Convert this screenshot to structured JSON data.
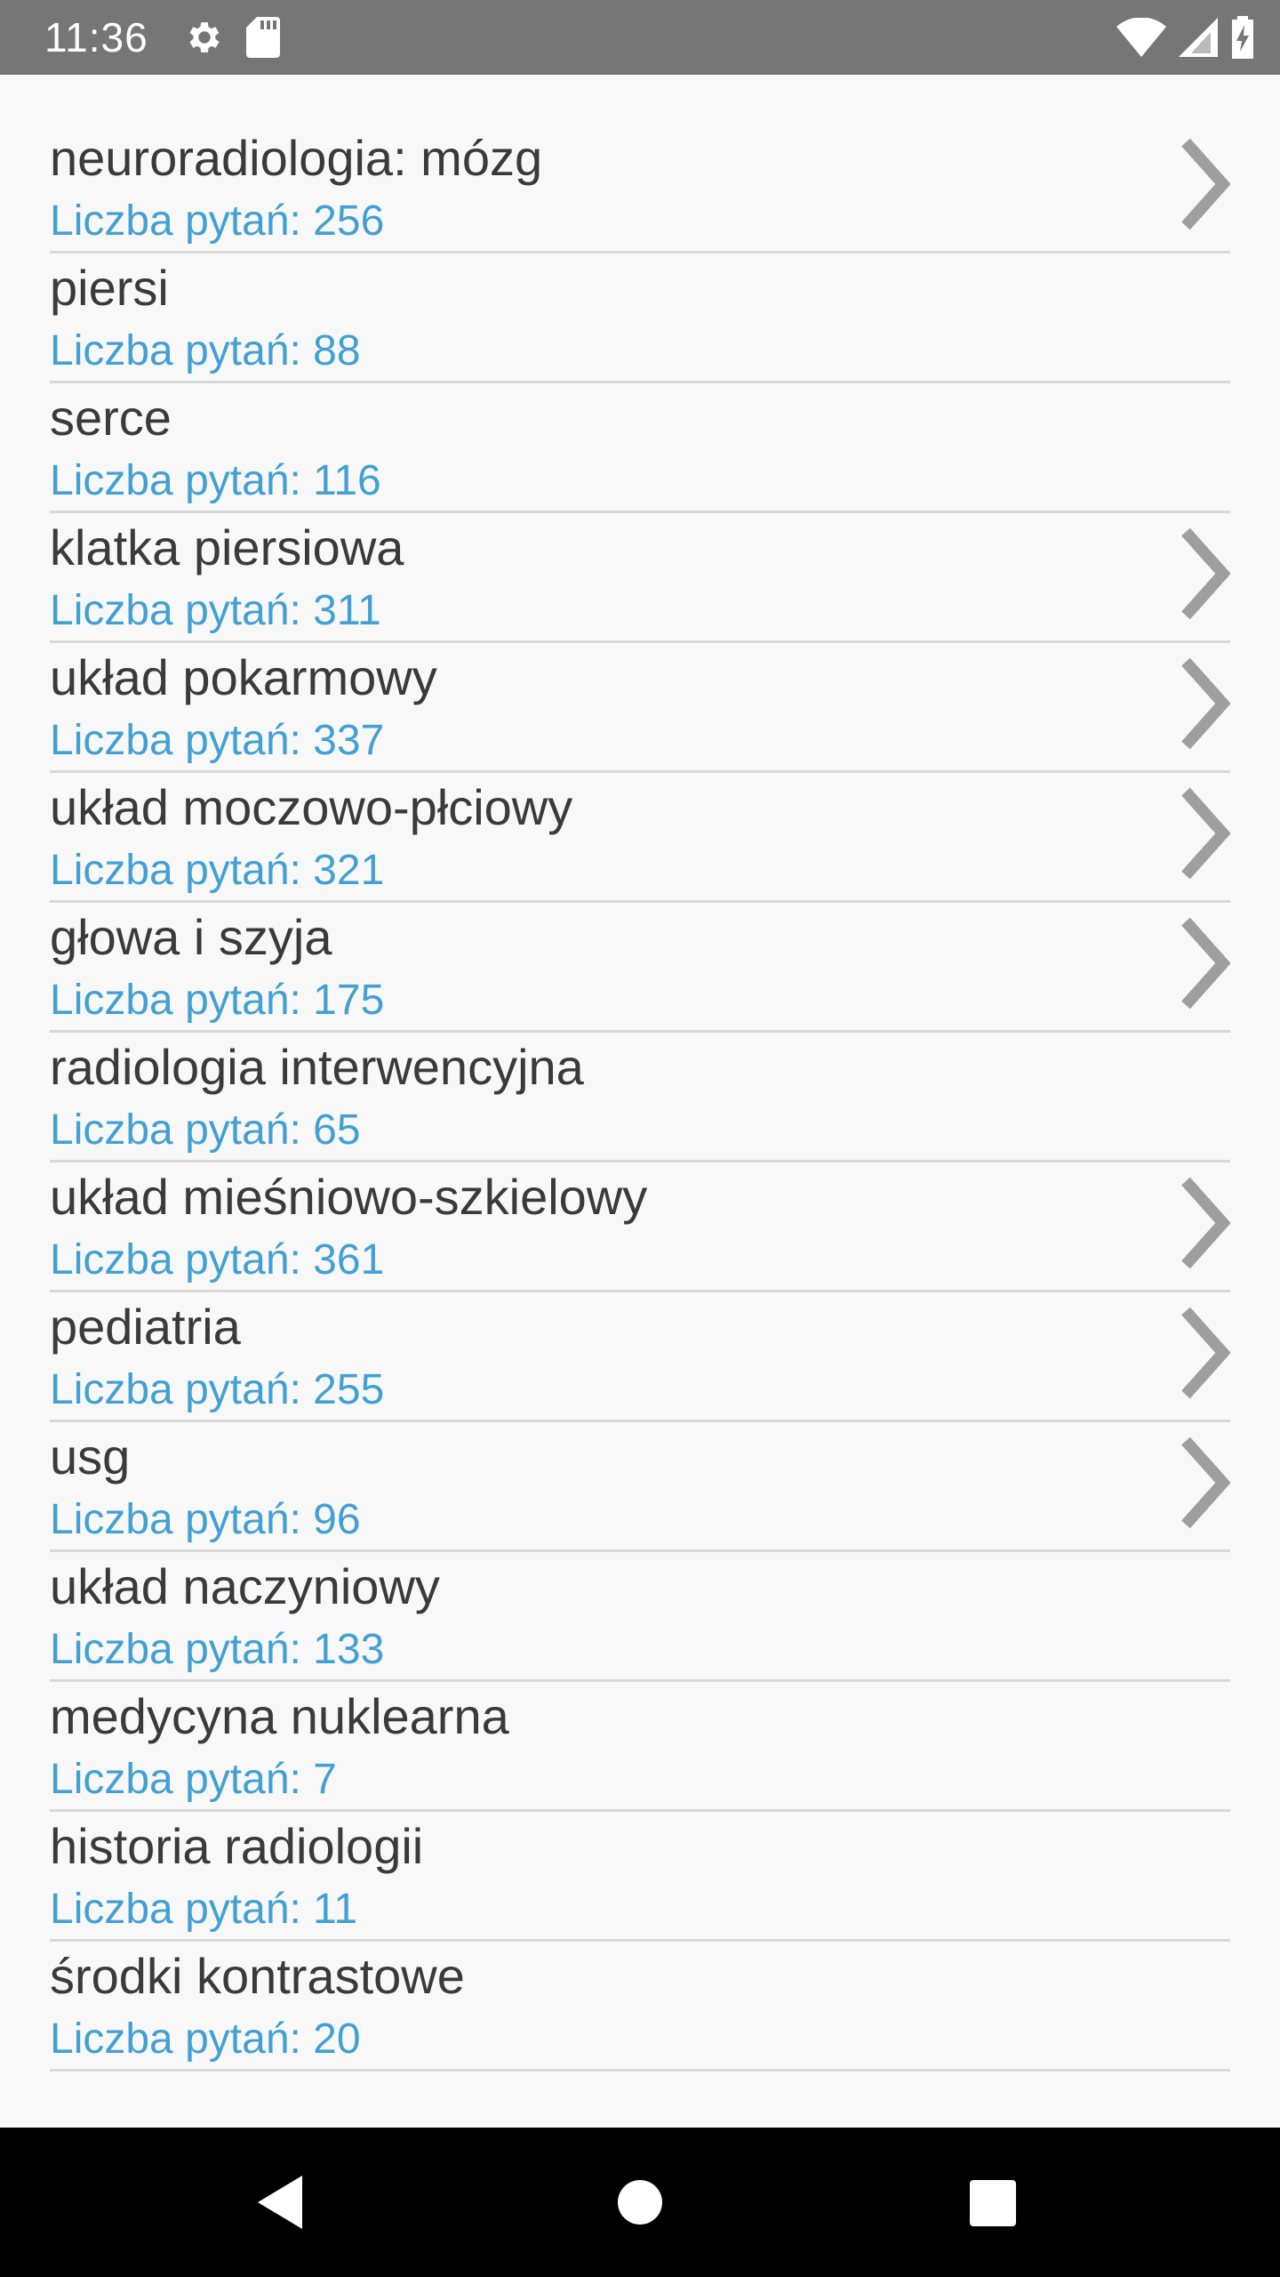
{
  "status_bar": {
    "time": "11:36",
    "icons": [
      "gear-icon",
      "sd-card-icon",
      "wifi-icon",
      "signal-icon",
      "battery-charging-icon"
    ]
  },
  "colors": {
    "status_bar_bg": "#767676",
    "background": "#f8f8f8",
    "title_text": "#3a3a3a",
    "count_text": "#43a0d3",
    "divider": "#d8d8d8",
    "chevron": "#9e9e9e",
    "nav_bar_bg": "#000000"
  },
  "categories": [
    {
      "title": "neuroradiologia: mózg",
      "count_label": "Liczba pytań: 256",
      "has_chevron": true
    },
    {
      "title": "piersi",
      "count_label": "Liczba pytań: 88",
      "has_chevron": false
    },
    {
      "title": "serce",
      "count_label": "Liczba pytań: 116",
      "has_chevron": false
    },
    {
      "title": "klatka piersiowa",
      "count_label": "Liczba pytań: 311",
      "has_chevron": true
    },
    {
      "title": "układ pokarmowy",
      "count_label": "Liczba pytań: 337",
      "has_chevron": true
    },
    {
      "title": "układ moczowo-płciowy",
      "count_label": "Liczba pytań: 321",
      "has_chevron": true
    },
    {
      "title": "głowa i szyja",
      "count_label": "Liczba pytań: 175",
      "has_chevron": true
    },
    {
      "title": "radiologia interwencyjna",
      "count_label": "Liczba pytań: 65",
      "has_chevron": false
    },
    {
      "title": "układ mieśniowo-szkielowy",
      "count_label": "Liczba pytań: 361",
      "has_chevron": true
    },
    {
      "title": "pediatria",
      "count_label": "Liczba pytań: 255",
      "has_chevron": true
    },
    {
      "title": "usg",
      "count_label": "Liczba pytań: 96",
      "has_chevron": true
    },
    {
      "title": "układ naczyniowy",
      "count_label": "Liczba pytań: 133",
      "has_chevron": false
    },
    {
      "title": "medycyna nuklearna",
      "count_label": "Liczba pytań: 7",
      "has_chevron": false
    },
    {
      "title": "historia radiologii",
      "count_label": "Liczba pytań: 11",
      "has_chevron": false
    },
    {
      "title": "środki kontrastowe",
      "count_label": "Liczba pytań: 20",
      "has_chevron": false
    }
  ],
  "nav_bar": {
    "icons": [
      "back-icon",
      "home-icon",
      "recents-icon"
    ]
  }
}
